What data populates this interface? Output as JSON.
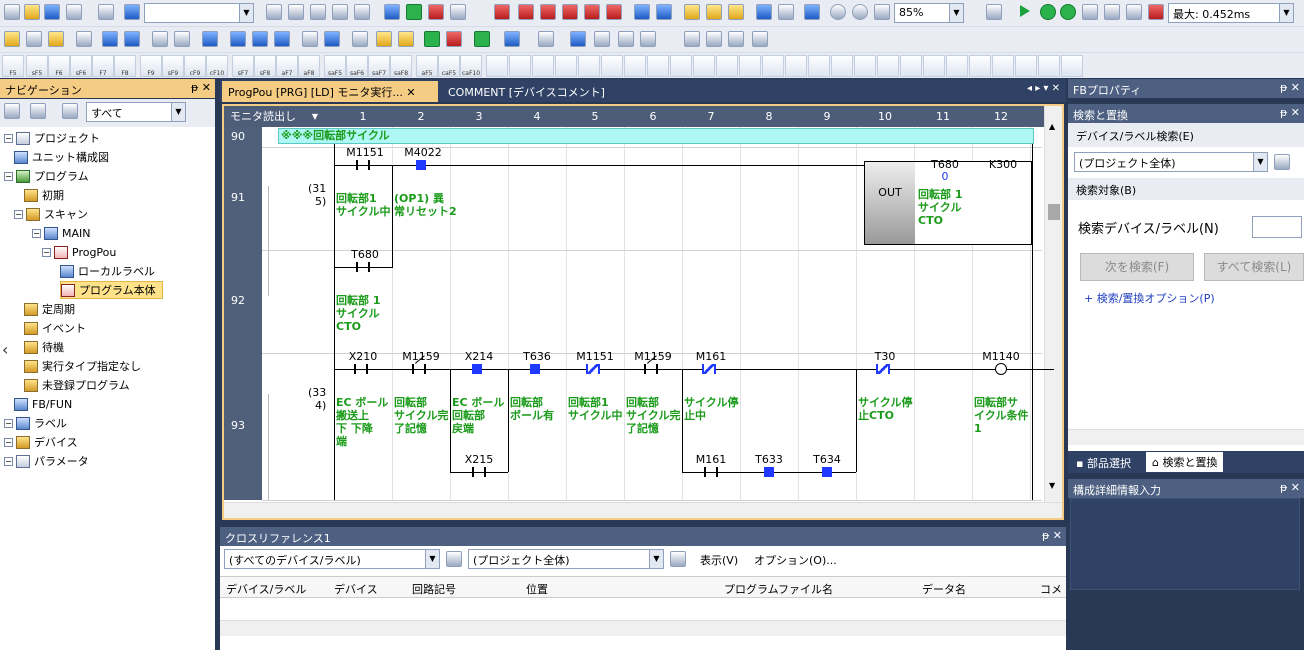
{
  "toolbar": {
    "zoom": "85%",
    "scan_time": "最大: 0.452ms"
  },
  "fkeys": [
    "F5",
    "sF5",
    "F6",
    "sF6",
    "F7",
    "F8",
    "F9",
    "sF9",
    "cF9",
    "cF10",
    "sF7",
    "sF8",
    "aF7",
    "aF8",
    "saF5",
    "saF6",
    "saF7",
    "saF8",
    "aF5",
    "caF5",
    "caF10"
  ],
  "nav": {
    "title": "ナビゲーション",
    "filter": "すべて",
    "tree": [
      {
        "label": "プロジェクト",
        "icon": "project"
      },
      {
        "label": "ユニット構成図",
        "icon": "unit"
      },
      {
        "label": "プログラム",
        "icon": "program"
      },
      {
        "label": "初期",
        "icon": "folder"
      },
      {
        "label": "スキャン",
        "icon": "folder"
      },
      {
        "label": "MAIN",
        "icon": "main"
      },
      {
        "label": "ProgPou",
        "icon": "pou"
      },
      {
        "label": "ローカルラベル",
        "icon": "label"
      },
      {
        "label": "プログラム本体",
        "icon": "body"
      },
      {
        "label": "定周期",
        "icon": "folder"
      },
      {
        "label": "イベント",
        "icon": "folder"
      },
      {
        "label": "待機",
        "icon": "folder"
      },
      {
        "label": "実行タイプ指定なし",
        "icon": "folder"
      },
      {
        "label": "未登録プログラム",
        "icon": "folder"
      },
      {
        "label": "FB/FUN",
        "icon": "fb"
      },
      {
        "label": "ラベル",
        "icon": "label"
      },
      {
        "label": "デバイス",
        "icon": "device"
      },
      {
        "label": "パラメータ",
        "icon": "param"
      }
    ]
  },
  "tabs": [
    {
      "label": "ProgPou [PRG] [LD] モニタ実行..."
    },
    {
      "label": "COMMENT [デバイスコメント]"
    }
  ],
  "ladder": {
    "mode": "モニタ読出し",
    "columns": [
      "1",
      "2",
      "3",
      "4",
      "5",
      "6",
      "7",
      "8",
      "9",
      "10",
      "11",
      "12"
    ],
    "statement": "※※※回転部サイクル",
    "rows": [
      {
        "num": "90"
      },
      {
        "num": "91",
        "step": "(31\n5)"
      },
      {
        "num": "92"
      },
      {
        "num": "93",
        "step": "(33\n4)"
      }
    ],
    "r91": {
      "c1": "M1151",
      "c2": "M4022",
      "cmt1": "回転部1\nサイクル中",
      "cmt2": "(OP1) 異\n常リセット2",
      "out": "OUT",
      "tdev": "T680",
      "tval": "0",
      "tcmt": "回転部 1\nサイクル\nCTO",
      "k": "K300"
    },
    "r92": {
      "dev": "T680",
      "cmt": "回転部 1\nサイクル\nCTO"
    },
    "r93": {
      "devs": [
        "X210",
        "M1159",
        "X214",
        "T636",
        "M1151",
        "M1159",
        "M161",
        "T30",
        "M1140"
      ],
      "cmts": [
        "EC ボール\n搬送上\n下 下降\n端",
        "回転部\nサイクル完\n了記憶",
        "EC ボール\n回転部\n戻端",
        "回転部\nボール有",
        "回転部1\nサイクル中",
        "回転部\nサイクル完\n了記憶",
        "サイクル停\n止中",
        "サイクル停\n止CTO",
        "回転部サ\nイクル条件\n1"
      ],
      "b2": [
        "X215",
        "M161",
        "T633",
        "T634"
      ]
    }
  },
  "right": {
    "fb_prop": "FBプロパティ",
    "search_title": "検索と置換",
    "search_menu": "デバイス/ラベル検索(E)",
    "scope": "(プロジェクト全体)",
    "target": "検索対象(B)",
    "label": "検索デバイス/ラベル(N)",
    "find_next": "次を検索(F)",
    "find_all": "すべて検索(L)",
    "options": "+ 検索/置換オプション(P)",
    "tab1": "部品選択",
    "tab2": "検索と置換",
    "detail": "構成詳細情報入力"
  },
  "xref": {
    "title": "クロスリファレンス1",
    "filter": "(すべてのデバイス/ラベル)",
    "scope": "(プロジェクト全体)",
    "view": "表示(V)",
    "option": "オプション(O)...",
    "headers": [
      "デバイス/ラベル",
      "デバイス",
      "回路記号",
      "位置",
      "プログラムファイル名",
      "データ名",
      "コメ"
    ]
  }
}
